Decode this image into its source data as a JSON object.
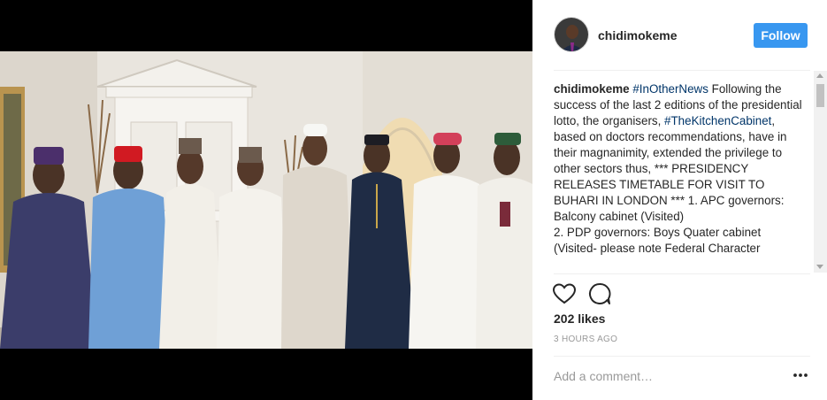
{
  "post": {
    "username": "chidimokeme",
    "follow_label": "Follow",
    "caption": {
      "username": "chidimokeme",
      "segments": [
        {
          "type": "tag",
          "text": "#InOtherNews"
        },
        {
          "type": "text",
          "text": " Following the success of the last 2 editions of the presidential lotto, the organisers, "
        },
        {
          "type": "tag",
          "text": "#TheKitchenCabinet"
        },
        {
          "type": "text",
          "text": ", based on doctors recommendations, have in their magnanimity, extended the privilege to other sectors thus, *** PRESIDENCY RELEASES TIMETABLE FOR VISIT TO BUHARI IN LONDON *** 1. APC governors: Balcony cabinet (Visited)"
        },
        {
          "type": "break"
        },
        {
          "type": "text",
          "text": "2. PDP governors: Boys Quater cabinet (Visited- please note Federal Character"
        }
      ]
    },
    "likes_text": "202 likes",
    "timestamp": "3 HOURS AGO",
    "comment_placeholder": "Add a comment…"
  },
  "icons": {
    "like": "heart-icon",
    "comment": "comment-icon",
    "more": "more-options-icon",
    "avatar": "avatar"
  },
  "colors": {
    "follow_button": "#3897f0",
    "hashtag": "#003569",
    "muted_text": "#999999",
    "divider": "#efefef"
  }
}
